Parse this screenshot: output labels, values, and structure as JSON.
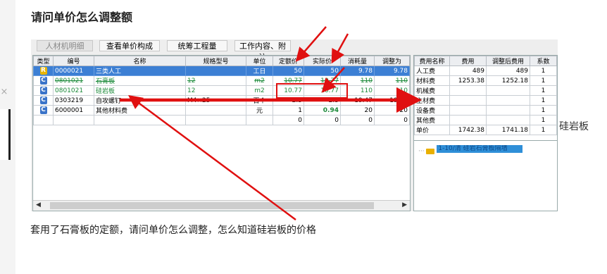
{
  "page_title": "请问单价怎么调整额",
  "toolbar": {
    "tabs": [
      "人材机明细",
      "查看单价构成",
      "统筹工程量",
      "工作内容、附注"
    ]
  },
  "grid": {
    "headers": [
      "类型",
      "编号",
      "名称",
      "规格型号",
      "单位",
      "定额价",
      "实际价",
      "消耗量",
      "调整为"
    ],
    "rows": [
      {
        "type": "R",
        "code": "0000021",
        "name": "三类人工",
        "spec": "",
        "unit": "工日",
        "quota": "50",
        "actual": "50",
        "consumption": "9.78",
        "adjusted": "9.78"
      },
      {
        "type": "C",
        "code": "0801021",
        "name": "石膏板",
        "spec": "12",
        "unit": "m2",
        "quota": "10.77",
        "actual": "10.77",
        "consumption": "110",
        "adjusted": "110"
      },
      {
        "type": "C",
        "code": "0801021",
        "name": "硅岩板",
        "spec": "12",
        "unit": "m2",
        "quota": "10.77",
        "actual": "10.77",
        "consumption": "110",
        "adjusted": "110"
      },
      {
        "type": "C",
        "code": "0303219",
        "name": "自攻螺钉",
        "spec": "M4×25",
        "unit": "百个",
        "quota": "2.5",
        "actual": "2.5",
        "consumption": "19.47",
        "adjusted": "19.47"
      },
      {
        "type": "C",
        "code": "6000001",
        "name": "其他材料费",
        "spec": "",
        "unit": "元",
        "quota": "1",
        "actual": "0.94",
        "consumption": "20",
        "adjusted": "20"
      },
      {
        "type": "",
        "code": "",
        "name": "",
        "spec": "",
        "unit": "",
        "quota": "0",
        "actual": "0",
        "consumption": "0",
        "adjusted": "0"
      }
    ]
  },
  "fee_table": {
    "headers": [
      "费用名称",
      "费用",
      "调整后费用",
      "系数"
    ],
    "rows": [
      {
        "name": "人工费",
        "fee": "489",
        "adjusted": "489",
        "coef": "1"
      },
      {
        "name": "材料费",
        "fee": "1253.38",
        "adjusted": "1252.18",
        "coef": "1"
      },
      {
        "name": "机械费",
        "fee": "",
        "adjusted": "",
        "coef": "1"
      },
      {
        "name": "主材费",
        "fee": "",
        "adjusted": "",
        "coef": "1"
      },
      {
        "name": "设备费",
        "fee": "",
        "adjusted": "",
        "coef": "1"
      },
      {
        "name": "其他费",
        "fee": "",
        "adjusted": "",
        "coef": "1"
      },
      {
        "name": "单价",
        "fee": "1742.38",
        "adjusted": "1741.18",
        "coef": "1"
      }
    ]
  },
  "tree": {
    "item_label": "1-10/清  硅岩石膏板隔墙"
  },
  "side_label": "硅岩板",
  "caption": "套用了石膏板的定额，请问单价怎么调整，怎么知道硅岩板的价格",
  "colors": {
    "annotation_red": "#e01010",
    "selected_row": "#3c7fd4",
    "green_text": "#1c8a3a"
  }
}
